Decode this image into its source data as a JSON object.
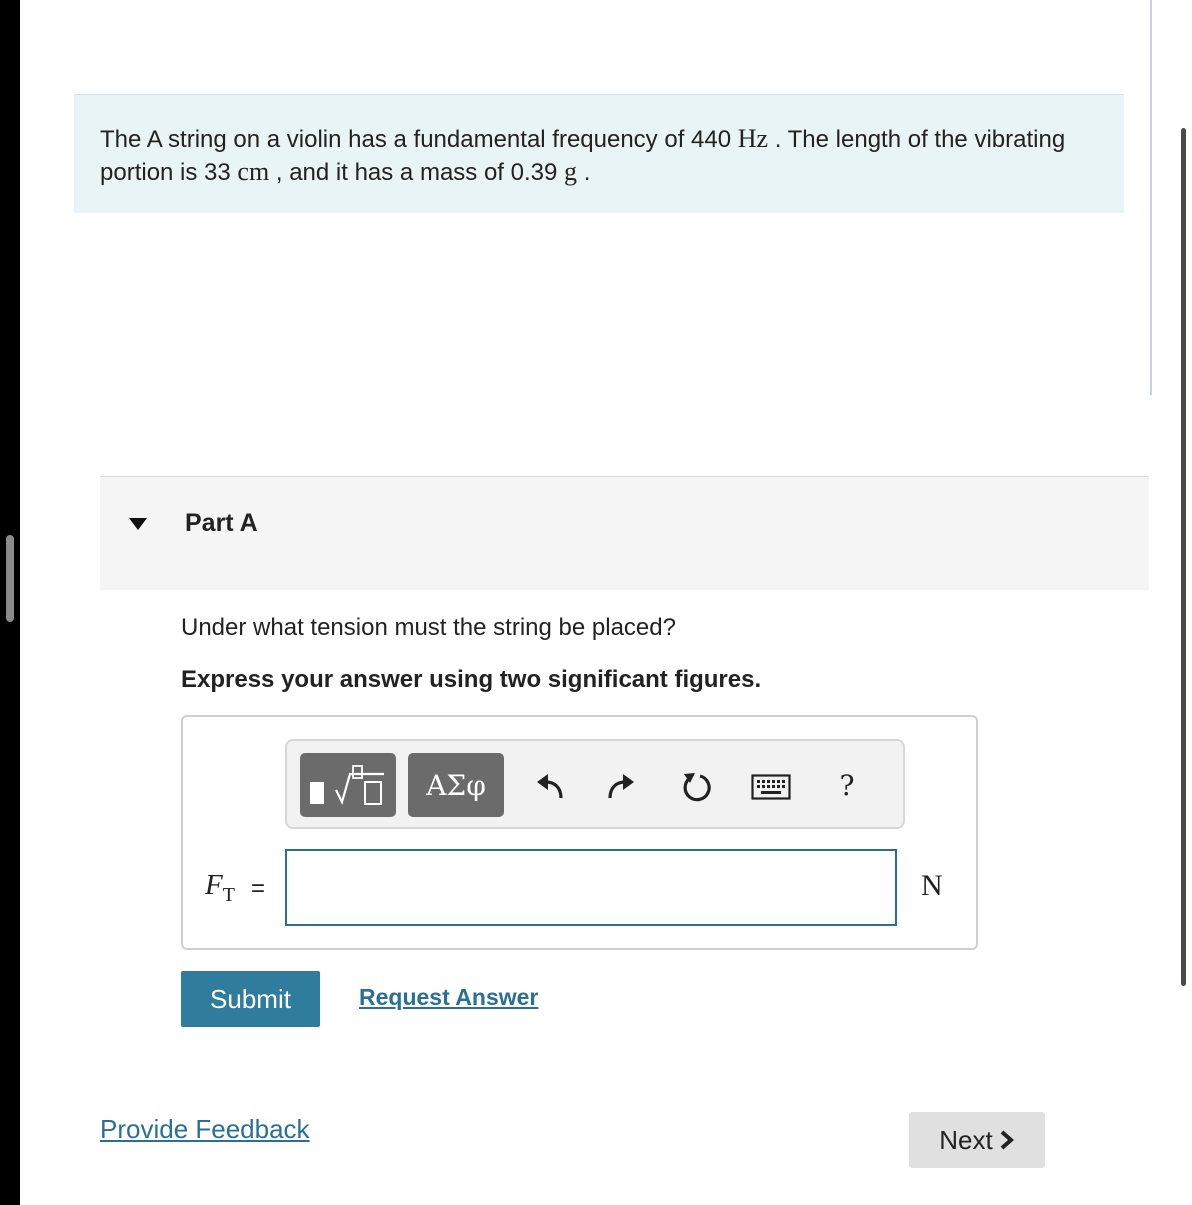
{
  "problem": {
    "text_1": "The A string on a violin has a fundamental frequency of 440 ",
    "unit_hz": "Hz",
    "text_2": " . The length of the vibrating portion is 33 ",
    "unit_cm": "cm",
    "text_3": " , and it has a mass of 0.39 ",
    "unit_g": "g",
    "text_4": " ."
  },
  "part": {
    "title": "Part A",
    "question": "Under what tension must the string be placed?",
    "instruction": "Express your answer using two significant figures."
  },
  "toolbar": {
    "greek_label": "ΑΣφ",
    "help_label": "?",
    "icons": [
      "templates-icon",
      "undo-icon",
      "redo-icon",
      "reset-icon",
      "keyboard-icon",
      "help-icon"
    ]
  },
  "answer": {
    "variable": "F",
    "subscript": "T",
    "equals": "=",
    "value": "",
    "unit": "N"
  },
  "actions": {
    "submit_label": "Submit",
    "request_label": "Request Answer",
    "feedback_label": "Provide Feedback",
    "next_label": "Next"
  },
  "colors": {
    "accent": "#2f7c9c",
    "link": "#2a6f96",
    "problem_bg": "#e8f4f5"
  }
}
